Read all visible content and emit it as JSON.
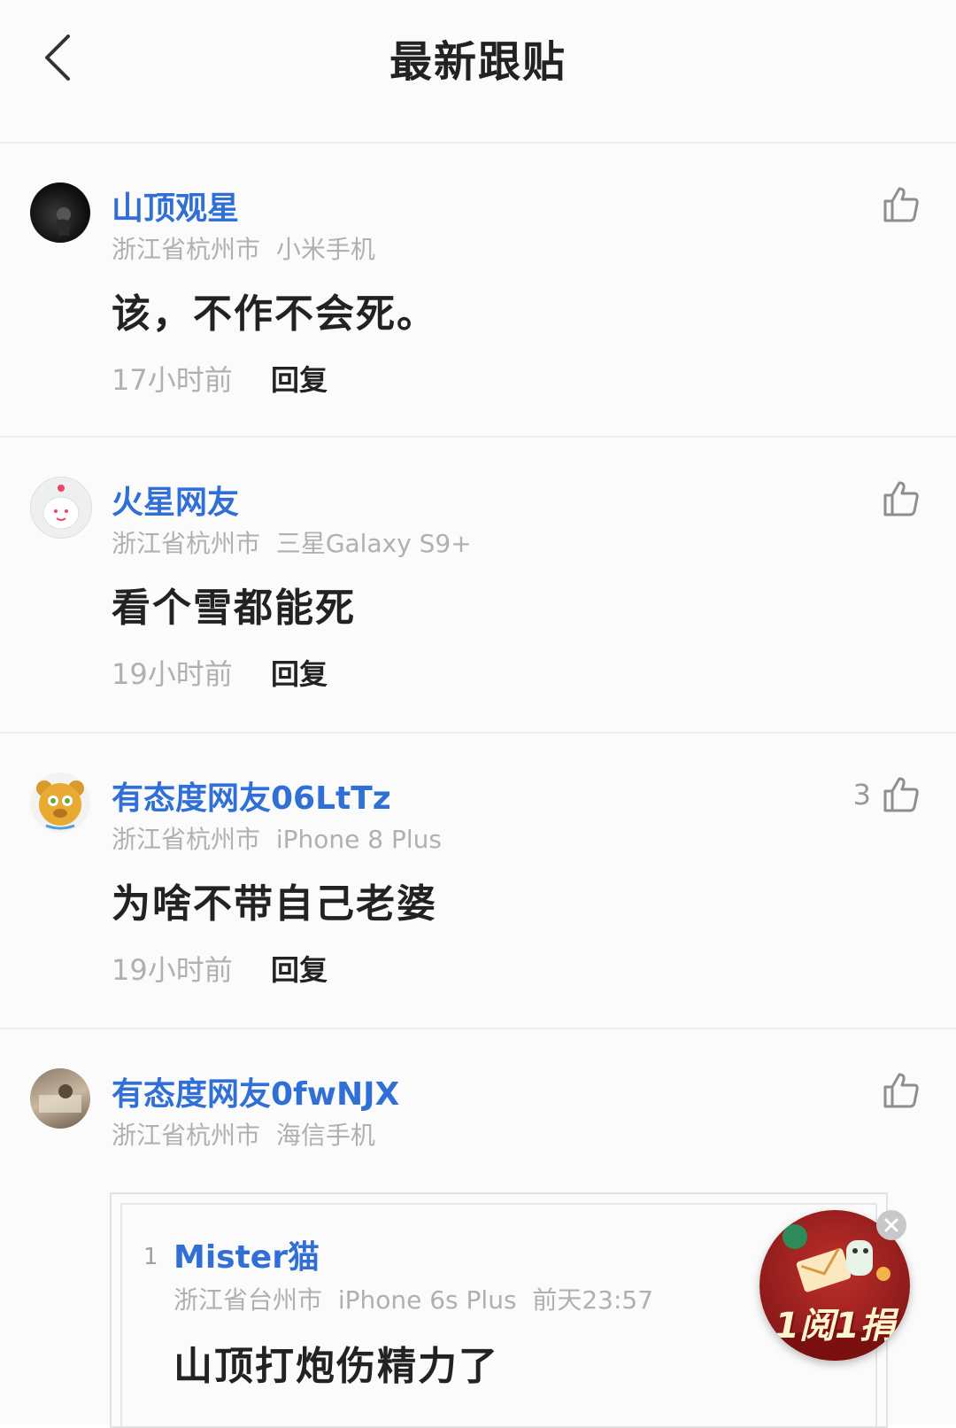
{
  "header": {
    "title": "最新跟贴"
  },
  "comments": [
    {
      "user": "山顶观星",
      "location": "浙江省杭州市",
      "device": "小米手机",
      "text": "该，不作不会死。",
      "time": "17小时前",
      "reply": "回复",
      "likes": ""
    },
    {
      "user": "火星网友",
      "location": "浙江省杭州市",
      "device": "三星Galaxy S9+",
      "text": "看个雪都能死",
      "time": "19小时前",
      "reply": "回复",
      "likes": ""
    },
    {
      "user": "有态度网友06LtTz",
      "location": "浙江省杭州市",
      "device": "iPhone 8 Plus",
      "text": "为啥不带自己老婆",
      "time": "19小时前",
      "reply": "回复",
      "likes": "3"
    },
    {
      "user": "有态度网友0fwNJX",
      "location": "浙江省杭州市",
      "device": "海信手机",
      "likes": ""
    }
  ],
  "quote": {
    "floor": "1",
    "user": "Mister猫",
    "location": "浙江省台州市",
    "device": "iPhone 6s Plus",
    "time": "前天23:57",
    "text": "山顶打炮伤精力了"
  },
  "promo": {
    "label": "1阅1捐"
  },
  "colors": {
    "username": "#2f6fd6",
    "meta": "#b0b0b0",
    "text": "#222222",
    "background": "#fbfbfb"
  }
}
